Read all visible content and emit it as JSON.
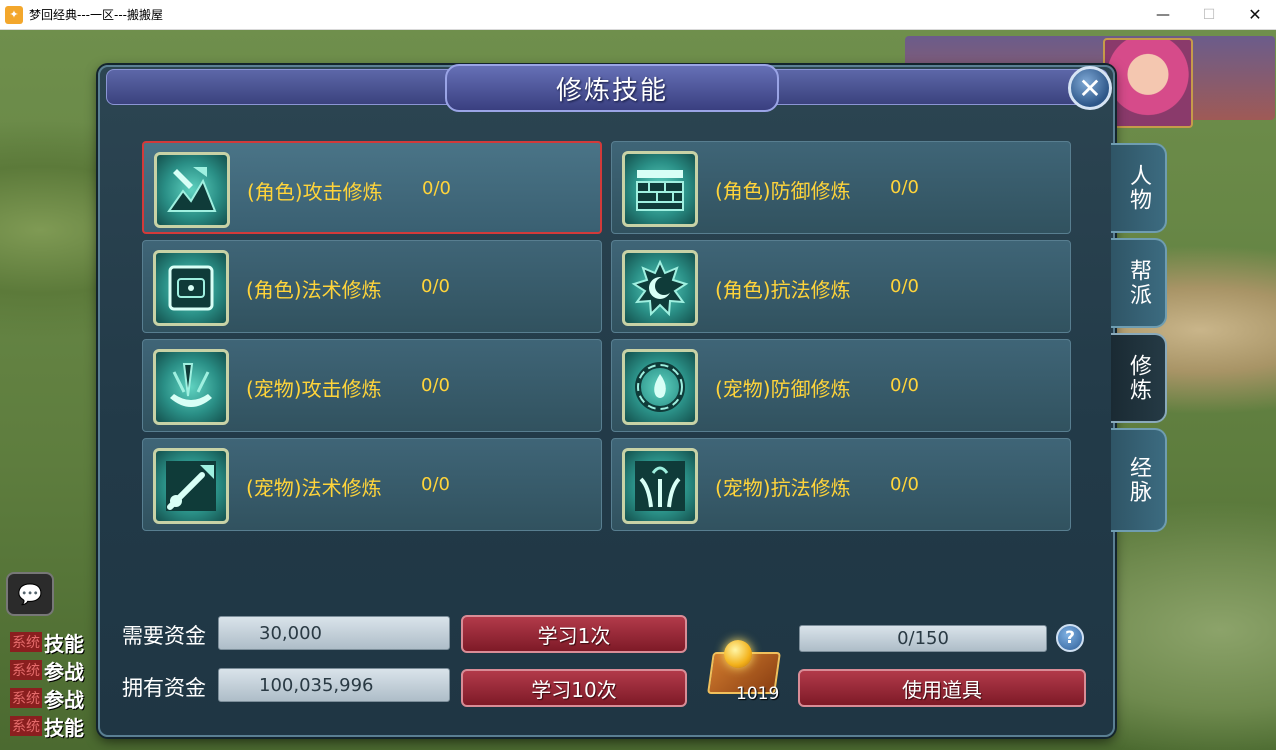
{
  "window": {
    "title": "梦回经典---一区---搬搬屋",
    "minimize": "—",
    "maximize": "☐",
    "close": "✕"
  },
  "dialog": {
    "title": "修炼技能",
    "close_glyph": "✕"
  },
  "skills": [
    {
      "name": "(角色)攻击修炼",
      "level": "0/0",
      "icon": "sword-axe-icon",
      "selected": true
    },
    {
      "name": "(角色)防御修炼",
      "level": "0/0",
      "icon": "wall-icon",
      "selected": false
    },
    {
      "name": "(角色)法术修炼",
      "level": "0/0",
      "icon": "scroll-frame-icon",
      "selected": false
    },
    {
      "name": "(角色)抗法修炼",
      "level": "0/0",
      "icon": "moon-sun-icon",
      "selected": false
    },
    {
      "name": "(宠物)攻击修炼",
      "level": "0/0",
      "icon": "claws-icon",
      "selected": false
    },
    {
      "name": "(宠物)防御修炼",
      "level": "0/0",
      "icon": "flame-ring-icon",
      "selected": false
    },
    {
      "name": "(宠物)法术修炼",
      "level": "0/0",
      "icon": "comet-icon",
      "selected": false
    },
    {
      "name": "(宠物)抗法修炼",
      "level": "0/0",
      "icon": "fountain-icon",
      "selected": false
    }
  ],
  "tabs": [
    {
      "label": "人物",
      "active": false
    },
    {
      "label": "帮派",
      "active": false
    },
    {
      "label": "修炼",
      "active": true
    },
    {
      "label": "经脉",
      "active": false
    }
  ],
  "funds": {
    "required_label": "需要资金",
    "required_value": "30,000",
    "owned_label": "拥有资金",
    "owned_value": "100,035,996"
  },
  "buttons": {
    "learn_once": "学习1次",
    "learn_ten": "学习10次",
    "use_item": "使用道具",
    "help": "?"
  },
  "item": {
    "count": "1019",
    "icon": "treasure-chest-icon"
  },
  "progress": {
    "text": "0/150",
    "current": 0,
    "max": 150
  },
  "chat": {
    "button_icon": "chat-bubble-icon",
    "lines": [
      {
        "tag": "系统",
        "text": "技能"
      },
      {
        "tag": "系统",
        "text": "参战"
      },
      {
        "tag": "系统",
        "text": "参战"
      },
      {
        "tag": "系统",
        "text": "技能"
      }
    ]
  },
  "colors": {
    "accent_text": "#ffd43a",
    "selected_border": "#d23a3a",
    "button_red": "#9c2a38"
  }
}
